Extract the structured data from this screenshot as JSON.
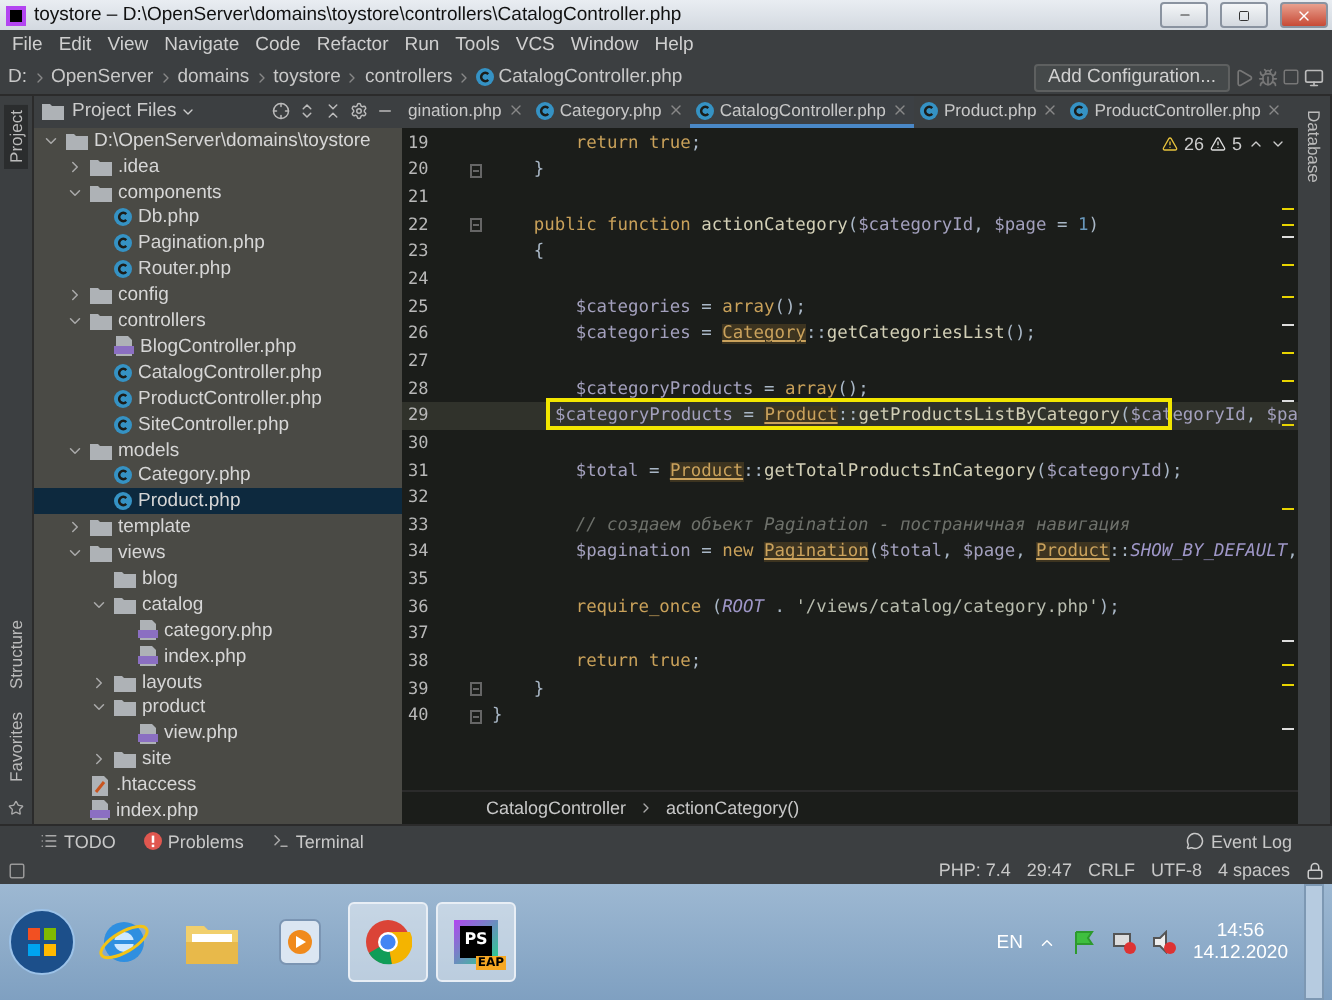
{
  "window": {
    "title": "toystore – D:\\OpenServer\\domains\\toystore\\controllers\\CatalogController.php"
  },
  "menu": [
    "File",
    "Edit",
    "View",
    "Navigate",
    "Code",
    "Refactor",
    "Run",
    "Tools",
    "VCS",
    "Window",
    "Help"
  ],
  "nav_path": [
    "D:",
    "OpenServer",
    "domains",
    "toystore",
    "controllers",
    "CatalogController.php"
  ],
  "run_config": "Add Configuration...",
  "left_stripe": [
    "Project",
    "Structure",
    "Favorites"
  ],
  "right_stripe": [
    "Database"
  ],
  "project": {
    "title": "Project Files",
    "tree": [
      {
        "label": "D:\\OpenServer\\domains\\toystore",
        "kind": "folder",
        "expanded": true,
        "selected": false,
        "children": [
          {
            "label": ".idea",
            "kind": "folder",
            "expanded": false,
            "selected": false
          },
          {
            "label": "components",
            "kind": "folder",
            "expanded": true,
            "selected": false,
            "children": [
              {
                "label": "Db.php",
                "kind": "class",
                "selected": false
              },
              {
                "label": "Pagination.php",
                "kind": "class",
                "selected": false
              },
              {
                "label": "Router.php",
                "kind": "class",
                "selected": false
              }
            ]
          },
          {
            "label": "config",
            "kind": "folder",
            "expanded": false,
            "selected": false
          },
          {
            "label": "controllers",
            "kind": "folder",
            "expanded": true,
            "selected": false,
            "children": [
              {
                "label": "BlogController.php",
                "kind": "php",
                "selected": false
              },
              {
                "label": "CatalogController.php",
                "kind": "class",
                "selected": false
              },
              {
                "label": "ProductController.php",
                "kind": "class",
                "selected": false
              },
              {
                "label": "SiteController.php",
                "kind": "class",
                "selected": false
              }
            ]
          },
          {
            "label": "models",
            "kind": "folder",
            "expanded": true,
            "selected": false,
            "children": [
              {
                "label": "Category.php",
                "kind": "class",
                "selected": false
              },
              {
                "label": "Product.php",
                "kind": "class",
                "selected": true
              }
            ]
          },
          {
            "label": "template",
            "kind": "folder",
            "expanded": false,
            "selected": false
          },
          {
            "label": "views",
            "kind": "folder",
            "expanded": true,
            "selected": false,
            "children": [
              {
                "label": "blog",
                "kind": "folder",
                "selected": false
              },
              {
                "label": "catalog",
                "kind": "folder",
                "expanded": true,
                "selected": false,
                "children": [
                  {
                    "label": "category.php",
                    "kind": "php",
                    "selected": false
                  },
                  {
                    "label": "index.php",
                    "kind": "php",
                    "selected": false
                  }
                ]
              },
              {
                "label": "layouts",
                "kind": "folder",
                "expanded": false,
                "selected": false
              },
              {
                "label": "product",
                "kind": "folder",
                "expanded": true,
                "selected": false,
                "children": [
                  {
                    "label": "view.php",
                    "kind": "php",
                    "selected": false
                  }
                ]
              },
              {
                "label": "site",
                "kind": "folder",
                "expanded": false,
                "selected": false
              }
            ]
          },
          {
            "label": ".htaccess",
            "kind": "htaccess",
            "selected": false
          },
          {
            "label": "index.php",
            "kind": "php",
            "selected": false
          }
        ]
      }
    ]
  },
  "tabs": [
    {
      "label": "gination.php",
      "selected": false
    },
    {
      "label": "Category.php",
      "selected": false
    },
    {
      "label": "CatalogController.php",
      "selected": true
    },
    {
      "label": "Product.php",
      "selected": false
    },
    {
      "label": "ProductController.php",
      "selected": false
    }
  ],
  "inspections": {
    "warnings": "26",
    "weak_warnings": "5"
  },
  "code": [
    {
      "number": "19",
      "current": false,
      "boxed": false,
      "fold": false,
      "tokens": [
        {
          "kind": "kw",
          "t": "        return true"
        },
        {
          "kind": "plain",
          "t": ";"
        }
      ]
    },
    {
      "number": "20",
      "current": false,
      "boxed": false,
      "fold": true,
      "tokens": [
        {
          "kind": "plain",
          "t": "    }"
        }
      ]
    },
    {
      "number": "21",
      "current": false,
      "boxed": false,
      "fold": false
    },
    {
      "number": "22",
      "current": false,
      "boxed": false,
      "fold": true,
      "tokens": [
        {
          "kind": "kw",
          "t": "    public function "
        },
        {
          "kind": "fn",
          "t": "actionCategory"
        },
        {
          "kind": "plain",
          "t": "("
        },
        {
          "kind": "var",
          "t": "$categoryId"
        },
        {
          "kind": "plain",
          "t": ", "
        },
        {
          "kind": "var",
          "t": "$page"
        },
        {
          "kind": "plain",
          "t": " = "
        },
        {
          "kind": "num",
          "t": "1"
        },
        {
          "kind": "plain",
          "t": ")"
        }
      ]
    },
    {
      "number": "23",
      "current": false,
      "boxed": false,
      "fold": false,
      "tokens": [
        {
          "kind": "plain",
          "t": "    {"
        }
      ]
    },
    {
      "number": "24",
      "current": false,
      "boxed": false,
      "fold": false
    },
    {
      "number": "25",
      "current": false,
      "boxed": false,
      "fold": false,
      "tokens": [
        {
          "kind": "var",
          "t": "        $categories"
        },
        {
          "kind": "plain",
          "t": " = "
        },
        {
          "kind": "kw",
          "t": "array"
        },
        {
          "kind": "plain",
          "t": "();"
        }
      ]
    },
    {
      "number": "26",
      "current": false,
      "boxed": false,
      "fold": false,
      "tokens": [
        {
          "kind": "var",
          "t": "        $categories"
        },
        {
          "kind": "plain",
          "t": " = "
        },
        {
          "kind": "cls",
          "t": "Category"
        },
        {
          "kind": "plain",
          "t": "::"
        },
        {
          "kind": "fn",
          "t": "getCategoriesList"
        },
        {
          "kind": "plain",
          "t": "();"
        }
      ]
    },
    {
      "number": "27",
      "current": false,
      "boxed": false,
      "fold": false
    },
    {
      "number": "28",
      "current": false,
      "boxed": false,
      "fold": false,
      "tokens": [
        {
          "kind": "var",
          "t": "        $categoryProducts"
        },
        {
          "kind": "plain",
          "t": " = "
        },
        {
          "kind": "kw",
          "t": "array"
        },
        {
          "kind": "plain",
          "t": "();"
        }
      ]
    },
    {
      "number": "29",
      "current": true,
      "boxed": true,
      "fold": false,
      "tokens": [
        {
          "kind": "var",
          "t": "        $categoryProducts"
        },
        {
          "kind": "plain",
          "t": " = "
        },
        {
          "kind": "cls",
          "t": "Product"
        },
        {
          "kind": "plain",
          "t": "::"
        },
        {
          "kind": "fn",
          "t": "getProductsListByCategory"
        },
        {
          "kind": "plain",
          "t": "("
        },
        {
          "kind": "var",
          "t": "$categoryId"
        },
        {
          "kind": "plain",
          "t": ", "
        },
        {
          "kind": "var",
          "t": "$pa"
        }
      ]
    },
    {
      "number": "30",
      "current": false,
      "boxed": false,
      "fold": false
    },
    {
      "number": "31",
      "current": false,
      "boxed": false,
      "fold": false,
      "tokens": [
        {
          "kind": "var",
          "t": "        $total"
        },
        {
          "kind": "plain",
          "t": " = "
        },
        {
          "kind": "cls",
          "t": "Product"
        },
        {
          "kind": "plain",
          "t": "::"
        },
        {
          "kind": "fn",
          "t": "getTotalProductsInCategory"
        },
        {
          "kind": "plain",
          "t": "("
        },
        {
          "kind": "var",
          "t": "$categoryId"
        },
        {
          "kind": "plain",
          "t": ");"
        }
      ]
    },
    {
      "number": "32",
      "current": false,
      "boxed": false,
      "fold": false
    },
    {
      "number": "33",
      "current": false,
      "boxed": false,
      "fold": false,
      "tokens": [
        {
          "kind": "cm",
          "t": "        // создаем объект Pagination - постраничная навигация"
        }
      ]
    },
    {
      "number": "34",
      "current": false,
      "boxed": false,
      "fold": false,
      "tokens": [
        {
          "kind": "var",
          "t": "        $pagination"
        },
        {
          "kind": "plain",
          "t": " = "
        },
        {
          "kind": "kw",
          "t": "new "
        },
        {
          "kind": "cls",
          "t": "Pagination"
        },
        {
          "kind": "plain",
          "t": "("
        },
        {
          "kind": "var",
          "t": "$total"
        },
        {
          "kind": "plain",
          "t": ", "
        },
        {
          "kind": "var",
          "t": "$page"
        },
        {
          "kind": "plain",
          "t": ", "
        },
        {
          "kind": "cls",
          "t": "Product"
        },
        {
          "kind": "plain",
          "t": "::"
        },
        {
          "kind": "const",
          "t": "SHOW_BY_DEFAULT"
        },
        {
          "kind": "plain",
          "t": ","
        }
      ]
    },
    {
      "number": "35",
      "current": false,
      "boxed": false,
      "fold": false
    },
    {
      "number": "36",
      "current": false,
      "boxed": false,
      "fold": false,
      "tokens": [
        {
          "kind": "kw",
          "t": "        require_once "
        },
        {
          "kind": "plain",
          "t": "("
        },
        {
          "kind": "const",
          "t": "ROOT"
        },
        {
          "kind": "plain",
          "t": " . "
        },
        {
          "kind": "str",
          "t": "'/views/catalog/category.php'"
        },
        {
          "kind": "plain",
          "t": ");"
        }
      ]
    },
    {
      "number": "37",
      "current": false,
      "boxed": false,
      "fold": false
    },
    {
      "number": "38",
      "current": false,
      "boxed": false,
      "fold": false,
      "tokens": [
        {
          "kind": "kw",
          "t": "        return true"
        },
        {
          "kind": "plain",
          "t": ";"
        }
      ]
    },
    {
      "number": "39",
      "current": false,
      "boxed": false,
      "fold": true,
      "tokens": [
        {
          "kind": "plain",
          "t": "    }"
        }
      ]
    },
    {
      "number": "40",
      "current": false,
      "boxed": false,
      "fold": true,
      "tokens": [
        {
          "kind": "plain",
          "t": "}"
        }
      ]
    }
  ],
  "breadcrumb": [
    "CatalogController",
    "actionCategory()"
  ],
  "tool_windows": [
    {
      "label": "TODO",
      "kind": "list"
    },
    {
      "label": "Problems",
      "kind": "problems"
    },
    {
      "label": "Terminal",
      "kind": "terminal"
    }
  ],
  "event_log": "Event Log",
  "status": [
    "PHP: 7.4",
    "29:47",
    "CRLF",
    "UTF-8",
    "4 spaces"
  ],
  "taskbar": {
    "apps": [
      {
        "kind": "ie",
        "selected": false
      },
      {
        "kind": "explorer",
        "selected": false
      },
      {
        "kind": "media",
        "selected": false
      },
      {
        "kind": "chrome",
        "selected": true
      },
      {
        "kind": "phpstorm",
        "selected": true,
        "logo": "PS",
        "badge": "EAP"
      }
    ],
    "language": "EN",
    "time": "14:56",
    "date": "14.12.2020"
  }
}
